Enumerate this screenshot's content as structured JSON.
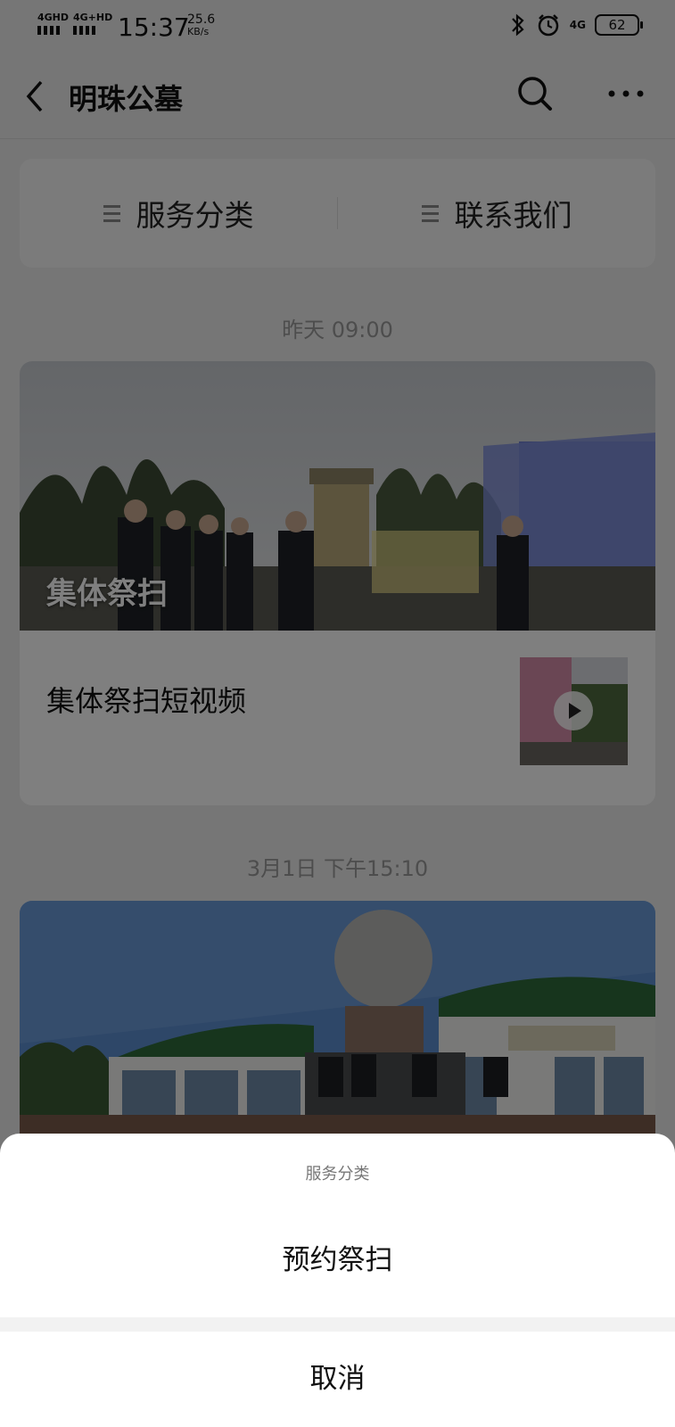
{
  "status_bar": {
    "signal_1": "4GHD",
    "signal_2": "4G+HD",
    "time": "15:37",
    "speed_value": "25.6",
    "speed_unit": "KB/s",
    "network": "4G",
    "battery": "62"
  },
  "nav": {
    "title": "明珠公墓",
    "back_icon": "chevron-left-icon",
    "search_icon": "search-icon",
    "more_icon": "more-icon"
  },
  "menu": {
    "items": [
      {
        "label": "服务分类",
        "icon": "menu-icon"
      },
      {
        "label": "联系我们",
        "icon": "menu-icon"
      }
    ]
  },
  "feed": [
    {
      "timestamp": "昨天 09:00",
      "cover_caption": "集体祭扫",
      "title": "集体祭扫短视频",
      "thumbnail_icon": "play-icon"
    },
    {
      "timestamp": "3月1日 下午15:10"
    }
  ],
  "action_sheet": {
    "title": "服务分类",
    "options": [
      "预约祭扫"
    ],
    "cancel": "取消"
  },
  "colors": {
    "background": "#ededed",
    "card": "#ffffff",
    "overlay": "rgba(0,0,0,0.5)",
    "muted_text": "#9a9a9a"
  }
}
